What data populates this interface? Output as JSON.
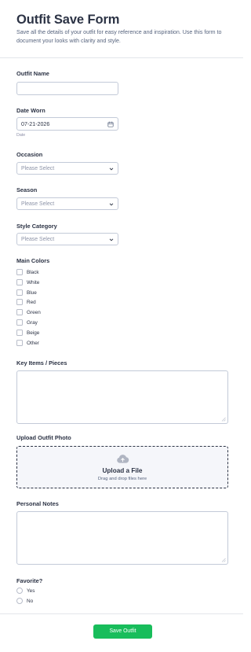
{
  "header": {
    "title": "Outfit Save Form",
    "description": "Save all the details of your outfit for easy reference and inspiration. Use this form to document your looks with clarity and style."
  },
  "fields": {
    "outfit_name": {
      "label": "Outfit Name",
      "value": ""
    },
    "date_worn": {
      "label": "Date Worn",
      "value": "07-21-2026",
      "sublabel": "Date"
    },
    "occasion": {
      "label": "Occasion",
      "selected": "Please Select"
    },
    "season": {
      "label": "Season",
      "selected": "Please Select"
    },
    "style_category": {
      "label": "Style Category",
      "selected": "Please Select"
    },
    "main_colors": {
      "label": "Main Colors",
      "options": [
        "Black",
        "White",
        "Blue",
        "Red",
        "Green",
        "Gray",
        "Beige",
        "Other"
      ]
    },
    "key_items": {
      "label": "Key Items / Pieces",
      "value": ""
    },
    "upload": {
      "label": "Upload Outfit Photo",
      "title": "Upload a File",
      "subtitle": "Drag and drop files here"
    },
    "personal_notes": {
      "label": "Personal Notes",
      "value": ""
    },
    "favorite": {
      "label": "Favorite?",
      "options": [
        "Yes",
        "No"
      ]
    }
  },
  "submit": {
    "label": "Save Outfit"
  },
  "colors": {
    "accent": "#18bd5b",
    "text": "#2c3345",
    "muted": "#57647e",
    "border": "#c3cad8",
    "upload_bg": "#f5f6fa"
  },
  "icons": {
    "date": "calendar-icon",
    "select": "chevron-down-icon",
    "upload": "cloud-upload-icon",
    "resize": "resize-grip-icon"
  }
}
